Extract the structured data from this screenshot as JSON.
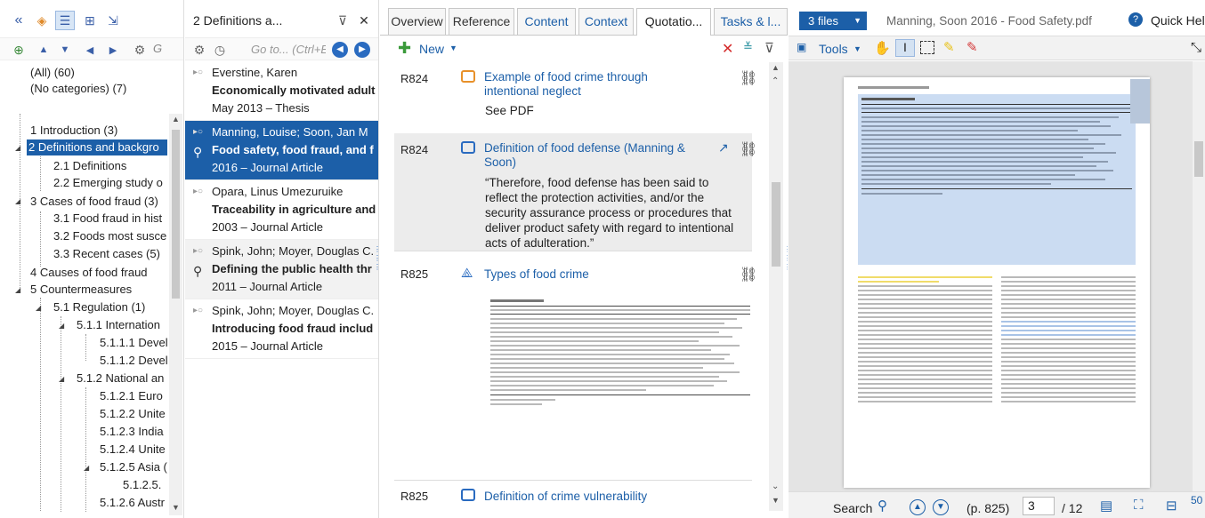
{
  "left_pane": {
    "filter_placeholder": "G",
    "category_all": "(All) (60)",
    "category_none": "(No categories) (7)",
    "tree": [
      {
        "label": "1 Introduction (3)"
      },
      {
        "label": "2 Definitions and backgro"
      },
      {
        "label": "2.1 Definitions"
      },
      {
        "label": "2.2 Emerging study o"
      },
      {
        "label": "3 Cases of food fraud (3)"
      },
      {
        "label": "3.1 Food fraud in hist"
      },
      {
        "label": "3.2 Foods most susce"
      },
      {
        "label": "3.3 Recent cases (5)"
      },
      {
        "label": "4 Causes of food fraud"
      },
      {
        "label": "5 Countermeasures"
      },
      {
        "label": "5.1 Regulation (1)"
      },
      {
        "label": "5.1.1 Internation"
      },
      {
        "label": "5.1.1.1 Devel"
      },
      {
        "label": "5.1.1.2 Devel"
      },
      {
        "label": "5.1.2 National an"
      },
      {
        "label": "5.1.2.1 Euro"
      },
      {
        "label": "5.1.2.2 Unite"
      },
      {
        "label": "5.1.2.3 India"
      },
      {
        "label": "5.1.2.4 Unite"
      },
      {
        "label": "5.1.2.5 Asia ("
      },
      {
        "label": "5.1.2.5."
      },
      {
        "label": "5.1.2.6 Austr"
      }
    ]
  },
  "refs_pane": {
    "title": "2 Definitions a...",
    "goto_placeholder": "Go to... (Ctrl+E",
    "items": [
      {
        "authors": "Everstine, Karen",
        "title": "Economically motivated adult",
        "meta": "May 2013 – Thesis"
      },
      {
        "authors": "Manning, Louise; Soon, Jan M",
        "title": "Food safety, food fraud, and f",
        "meta": "2016 – Journal Article"
      },
      {
        "authors": "Opara, Linus Umezuruike",
        "title": "Traceability in agriculture and",
        "meta": "2003 – Journal Article"
      },
      {
        "authors": "Spink, John; Moyer, Douglas C.",
        "title": "Defining the public health thr",
        "meta": "2011 – Journal Article"
      },
      {
        "authors": "Spink, John; Moyer, Douglas C.",
        "title": "Introducing food fraud includ",
        "meta": "2015 – Journal Article"
      }
    ]
  },
  "tabs": [
    "Overview",
    "Reference",
    "Content",
    "Context",
    "Quotatio...",
    "Tasks & l..."
  ],
  "quotes_pane": {
    "new_label": "New",
    "items": [
      {
        "id": "R824",
        "title": "Example of food crime through intentional neglect",
        "body": "See PDF"
      },
      {
        "id": "R824",
        "title": "Definition of food defense (Manning & Soon)",
        "body": "“Therefore, food defense has been said to reflect the protection activities, and/or the security assurance process or procedures that deliver product safety with regard to intentional acts of adulteration.”"
      },
      {
        "id": "R825",
        "title": "Types of food crime",
        "body": ""
      },
      {
        "id": "R825",
        "title": "Definition of crime vulnerability",
        "body": ""
      }
    ]
  },
  "pdf_pane": {
    "files_label": "3 files",
    "doc_title": "Manning, Soon 2016 - Food Safety.pdf",
    "help_label": "Quick Help",
    "tools_label": "Tools",
    "search_label": "Search",
    "page_label": "(p. 825)",
    "page_value": "3",
    "page_total": "/ 12",
    "zoom": "50"
  }
}
